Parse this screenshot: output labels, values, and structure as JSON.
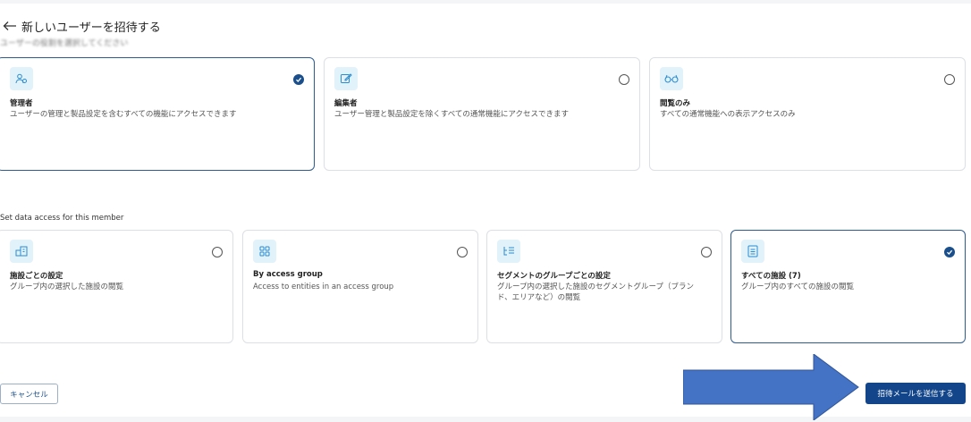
{
  "header": {
    "title": "新しいユーザーを招待する",
    "subtitle": "ユーザーの役割を選択してください"
  },
  "roles": [
    {
      "icon": "users-icon",
      "title": "管理者",
      "description": "ユーザーの管理と製品設定を含むすべての機能にアクセスできます",
      "selected": true
    },
    {
      "icon": "edit-icon",
      "title": "編集者",
      "description": "ユーザー管理と製品設定を除くすべての通常機能にアクセスできます",
      "selected": false
    },
    {
      "icon": "glasses-icon",
      "title": "閲覧のみ",
      "description": "すべての通常機能への表示アクセスのみ",
      "selected": false
    }
  ],
  "data_access": {
    "label": "Set data access for this member",
    "options": [
      {
        "icon": "building-icon",
        "title": "施設ごとの設定",
        "description": "グループ内の選択した施設の閲覧",
        "selected": false
      },
      {
        "icon": "grid-icon",
        "title": "By access group",
        "description": "Access to entities in an access group",
        "selected": false
      },
      {
        "icon": "hierarchy-icon",
        "title": "セグメントのグループごとの設定",
        "description": "グループ内の選択した施設のセグメントグループ（ブランド、エリアなど）の閲覧",
        "selected": false
      },
      {
        "icon": "list-icon",
        "title": "すべての施設 (7)",
        "description": "グループ内のすべての施設の閲覧",
        "selected": true
      }
    ]
  },
  "footer": {
    "cancel_label": "キャンセル",
    "send_label": "招待メールを送信する"
  },
  "colors": {
    "accent": "#12458a",
    "selected_border": "#2d5a8f",
    "icon_bg": "#e2f2fb",
    "annotation_arrow": "#4472c4"
  }
}
